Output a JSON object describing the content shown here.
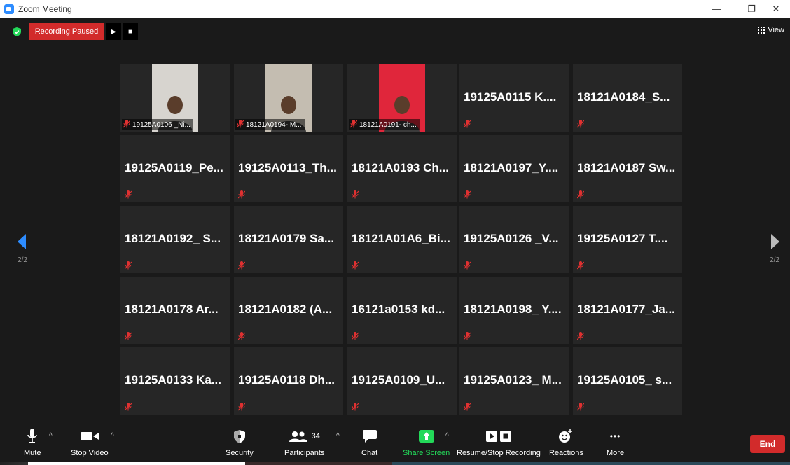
{
  "window": {
    "title": "Zoom Meeting",
    "minimize": "—",
    "restore": "❐",
    "close": "✕"
  },
  "top": {
    "recording_status": "Recording Paused",
    "resume_icon": "▶",
    "stop_icon": "■",
    "view_label": "View"
  },
  "colors": {
    "recording_red": "#d22b2b",
    "share_green": "#23d959",
    "arrow_blue": "#2d8cff",
    "tile_bg": "#262626"
  },
  "pagination": {
    "left": "2/2",
    "right": "2/2"
  },
  "participants": [
    {
      "label": "19125A0106 _Ni...",
      "video": true,
      "bg": "#d7d4cf"
    },
    {
      "label": "18121A0194- M...",
      "video": true,
      "bg": "#c4bdb1"
    },
    {
      "label": "18121A0191- ch...",
      "video": true,
      "bg": "#e0263b"
    },
    {
      "name": "19125A0115  K...."
    },
    {
      "name": "18121A0184_S..."
    },
    {
      "name": "19125A0119_Pe..."
    },
    {
      "name": "19125A0113_Th..."
    },
    {
      "name": "18121A0193  Ch..."
    },
    {
      "name": "18121A0197_Y...."
    },
    {
      "name": "18121A0187  Sw..."
    },
    {
      "name": "18121A0192_  S..."
    },
    {
      "name": "18121A0179  Sa..."
    },
    {
      "name": "18121A01A6_Bi..."
    },
    {
      "name": "19125A0126  _V..."
    },
    {
      "name": "19125A0127  T...."
    },
    {
      "name": "18121A0178  Ar..."
    },
    {
      "name": "18121A0182  (A..."
    },
    {
      "name": "16121a0153  kd..."
    },
    {
      "name": "18121A0198_  Y...."
    },
    {
      "name": "18121A0177_Ja..."
    },
    {
      "name": "19125A0133  Ka..."
    },
    {
      "name": "19125A0118  Dh..."
    },
    {
      "name": "19125A0109_U..."
    },
    {
      "name": "19125A0123_  M..."
    },
    {
      "name": "19125A0105_  s..."
    }
  ],
  "toolbar": {
    "mute": "Mute",
    "stop_video": "Stop Video",
    "security": "Security",
    "participants": "Participants",
    "participant_count": "34",
    "chat": "Chat",
    "share_screen": "Share Screen",
    "resume_stop_recording": "Resume/Stop Recording",
    "reactions": "Reactions",
    "more": "More",
    "more_icon": "•••",
    "caret": "^",
    "end": "End"
  }
}
